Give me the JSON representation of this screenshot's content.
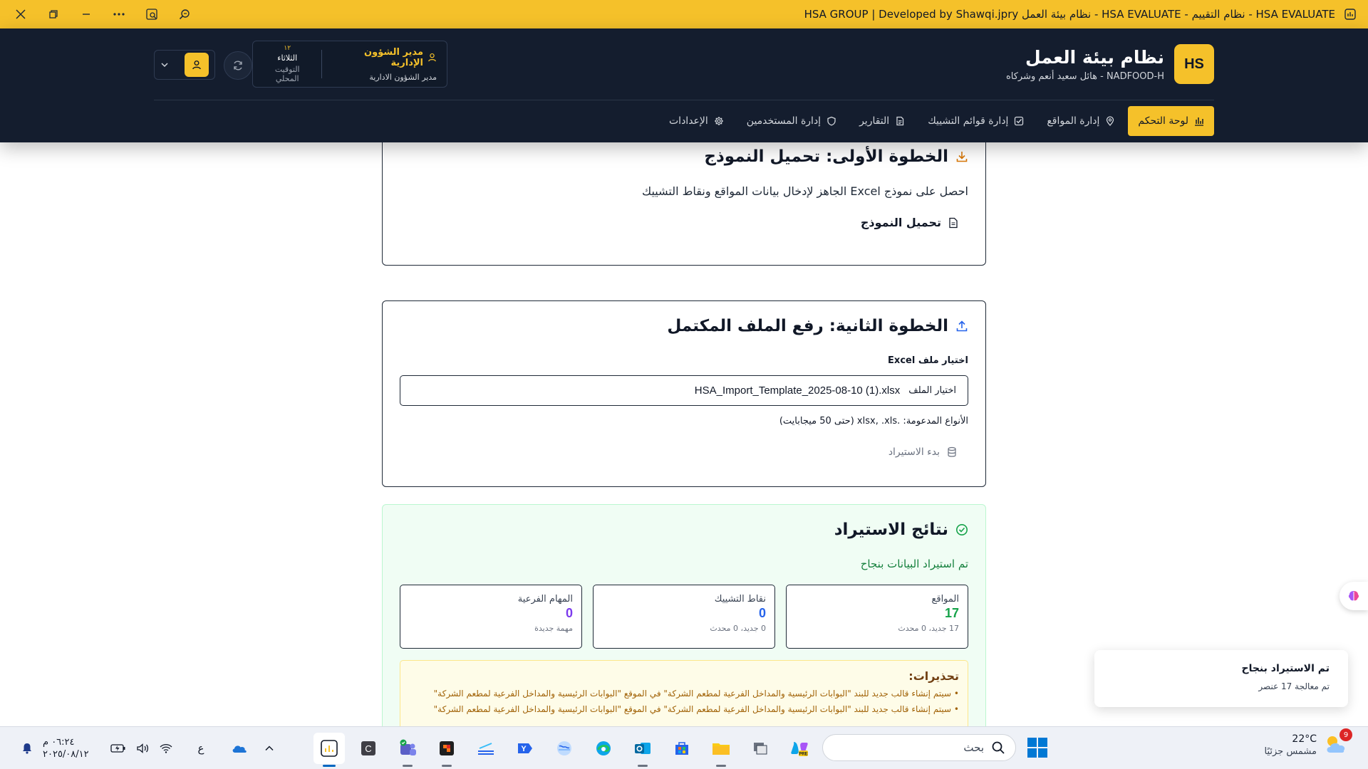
{
  "window": {
    "title": "HSA GROUP | Developed by Shawqi.jpry نظام بيئة العمل - HSA EVALUATE - نظام التقييم - HSA EVALUATE"
  },
  "header": {
    "logo_text": "HS",
    "title": "نظام بيئة العمل",
    "subtitle": "NADFOOD-H - هائل سعيد أنعم وشركاه",
    "user": {
      "role": "مدير الشؤون الإدارية",
      "department": "مدير الشؤون الادارية"
    },
    "time": {
      "number": "١٢",
      "day": "الثلاثاء",
      "label": "التوقيت المحلي"
    }
  },
  "nav": {
    "items": [
      {
        "label": "لوحة التحكم",
        "icon": "bar-chart-icon",
        "active": true
      },
      {
        "label": "إدارة المواقع",
        "icon": "map-pin-icon",
        "active": false
      },
      {
        "label": "إدارة قوائم التشييك",
        "icon": "checkbox-icon",
        "active": false
      },
      {
        "label": "التقارير",
        "icon": "document-icon",
        "active": false
      },
      {
        "label": "إدارة المستخدمين",
        "icon": "shield-icon",
        "active": false
      },
      {
        "label": "الإعدادات",
        "icon": "gear-icon",
        "active": false
      }
    ]
  },
  "step1": {
    "title": "الخطوة الأولى: تحميل النموذج",
    "description": "احصل على نموذج Excel الجاهز لإدخال بيانات المواقع ونقاط التشييك",
    "button": "تحميل النموذج"
  },
  "step2": {
    "title": "الخطوة الثانية: رفع الملف المكتمل",
    "field_label": "اختيار ملف Excel",
    "choose_button": "اختيار الملف",
    "file_name": "HSA_Import_Template_2025-08-10 (1).xlsx",
    "hint": "الأنواع المدعومة: .xlsx, .xls (حتى 50 ميجابايت)",
    "import_button": "بدء الاستيراد"
  },
  "results": {
    "title": "نتائج الاستيراد",
    "success": "تم استيراد البيانات بنجاح",
    "stats": [
      {
        "label": "المواقع",
        "value": "17",
        "sub": "17 جديد، 0 محدث",
        "color": "#16a34a"
      },
      {
        "label": "نقاط التشييك",
        "value": "0",
        "sub": "0 جديد، 0 محدث",
        "color": "#2563eb"
      },
      {
        "label": "المهام الفرعية",
        "value": "0",
        "sub": "مهمة جديدة",
        "color": "#7c3aed"
      }
    ],
    "warnings_title": "تحذيرات:",
    "warnings": [
      "• سيتم إنشاء قالب جديد للبند \"البوابات الرئيسية والمداخل الفرعية لمطعم الشركة\" في الموقع \"البوابات الرئيسية والمداخل الفرعية لمطعم الشركة\"",
      "• سيتم إنشاء قالب جديد للبند \"البوابات الرئيسية والمداخل الفرعية لمطعم الشركة\" في الموقع \"البوابات الرئيسية والمداخل الفرعية لمطعم الشركة\""
    ]
  },
  "toast": {
    "title": "تم الاستيراد بنجاح",
    "description": "تم معالجة 17 عنصر"
  },
  "taskbar": {
    "weather_temp": "22°C",
    "weather_condition": "مشمس جزئيًا",
    "weather_badge": "9",
    "search_placeholder": "بحث",
    "language": "ع",
    "clock_time": "٠٦:٢٤ م",
    "clock_date": "٢٠٢٥/٠٨/١٢"
  },
  "colors": {
    "accent": "#f5c12a",
    "header_bg": "#141d2e",
    "success": "#15803d"
  }
}
